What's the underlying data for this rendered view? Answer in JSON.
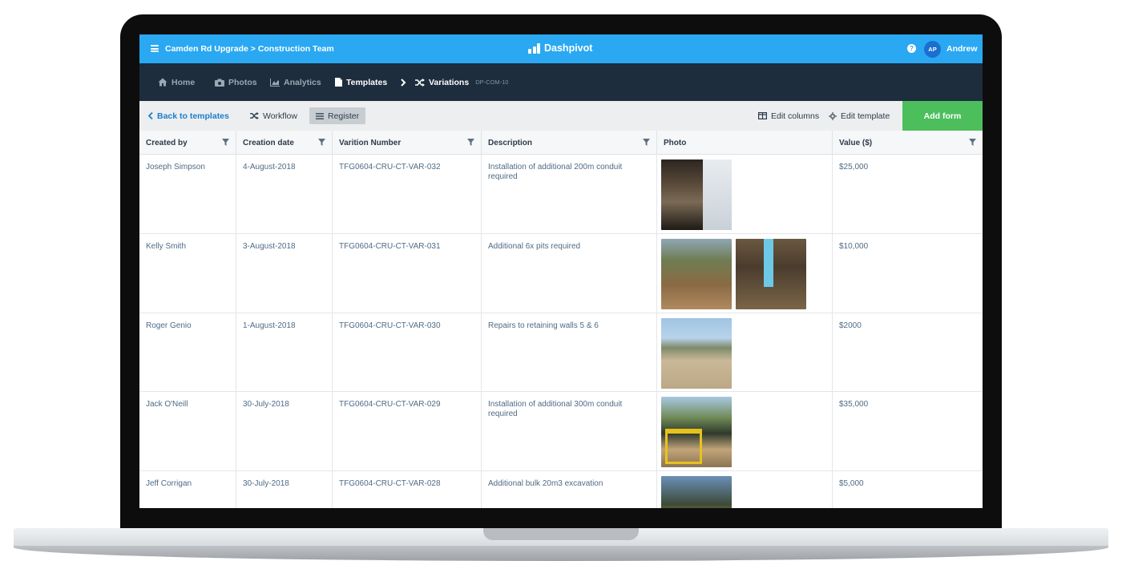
{
  "header": {
    "breadcrumb": "Camden Rd Upgrade > Construction Team",
    "brand": "Dashpivot",
    "avatar_initials": "AP",
    "username": "Andrew",
    "accent_color": "#2aa8f2"
  },
  "nav": {
    "items": [
      {
        "label": "Home",
        "icon": "home-icon"
      },
      {
        "label": "Photos",
        "icon": "camera-icon"
      },
      {
        "label": "Analytics",
        "icon": "chart-icon"
      },
      {
        "label": "Templates",
        "icon": "file-icon"
      }
    ],
    "current": {
      "label": "Variations",
      "code": "DP-COM-10",
      "icon": "shuffle-icon"
    }
  },
  "toolbar": {
    "back_label": "Back to templates",
    "workflow_label": "Workflow",
    "register_label": "Register",
    "edit_columns_label": "Edit columns",
    "edit_template_label": "Edit template",
    "add_form_label": "Add form",
    "add_form_color": "#4cbf5c"
  },
  "table": {
    "columns": [
      "Created by",
      "Creation date",
      "Varition Number",
      "Description",
      "Photo",
      "Value ($)"
    ],
    "rows": [
      {
        "created_by": "Joseph Simpson",
        "date": "4-August-2018",
        "number": "TFG0604-CRU-CT-VAR-032",
        "description": "Installation of additional 200m conduit required",
        "value": "$25,000"
      },
      {
        "created_by": "Kelly Smith",
        "date": "3-August-2018",
        "number": "TFG0604-CRU-CT-VAR-031",
        "description": "Additional 6x pits required",
        "value": "$10,000"
      },
      {
        "created_by": "Roger Genio",
        "date": "1-August-2018",
        "number": "TFG0604-CRU-CT-VAR-030",
        "description": "Repairs to retaining walls 5 & 6",
        "value": "$2000"
      },
      {
        "created_by": "Jack O'Neill",
        "date": "30-July-2018",
        "number": "TFG0604-CRU-CT-VAR-029",
        "description": "Installation of additional 300m conduit required",
        "value": "$35,000"
      },
      {
        "created_by": "Jeff Corrigan",
        "date": "30-July-2018",
        "number": "TFG0604-CRU-CT-VAR-028",
        "description": "Additional bulk 20m3 excavation",
        "value": "$5,000"
      }
    ]
  }
}
